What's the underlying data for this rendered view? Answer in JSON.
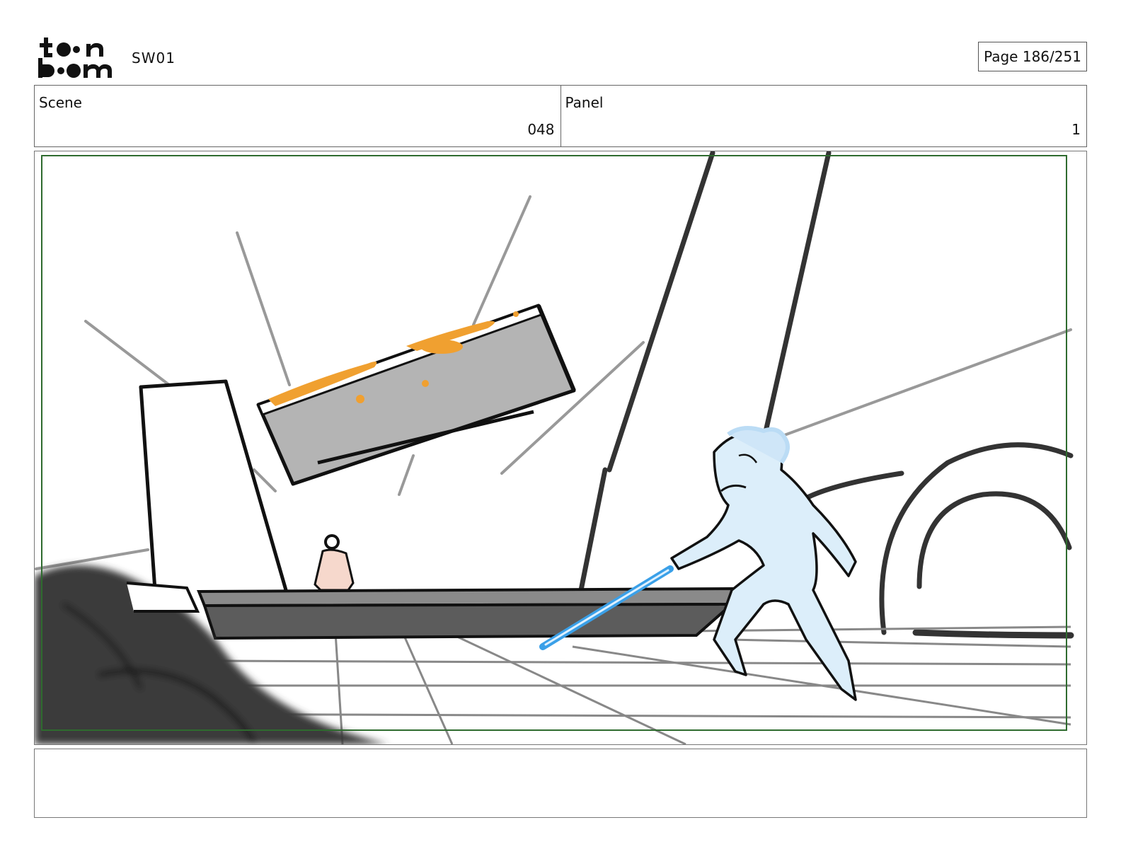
{
  "header": {
    "project": "SW01",
    "page": "Page 186/251"
  },
  "scene": {
    "label": "Scene",
    "value": "048"
  },
  "panel": {
    "label": "Panel",
    "value": "1"
  },
  "notes": {
    "text": ""
  },
  "colors": {
    "safe_frame": "#2e6b2e",
    "character_fill": "#dceefa",
    "saber": "#3aa0e8",
    "hot_metal": "#f0a030",
    "figure_fill": "#f6d8cc"
  },
  "logo": {
    "name": "toon-boom-logo",
    "lettering": "toon boom"
  }
}
